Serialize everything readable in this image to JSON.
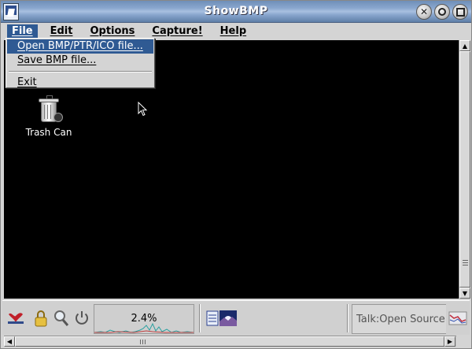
{
  "window": {
    "title": "ShowBMP"
  },
  "menubar": {
    "items": [
      "File",
      "Edit",
      "Options",
      "Capture!",
      "Help"
    ],
    "active_index": 0
  },
  "file_menu": {
    "items": [
      "Open BMP/PTR/ICO file...",
      "Save BMP file...",
      "Exit"
    ],
    "highlighted_index": 0
  },
  "desktop": {
    "icon_label": "Trash Can",
    "icon_name": "trash-can-icon"
  },
  "panel": {
    "cpu_load_text": "2.4%",
    "talk_text": "Talk:Open Source Ca"
  },
  "colors": {
    "highlight": "#2f5a93",
    "client_background": "#000000",
    "chrome": "#d4d4d4"
  }
}
